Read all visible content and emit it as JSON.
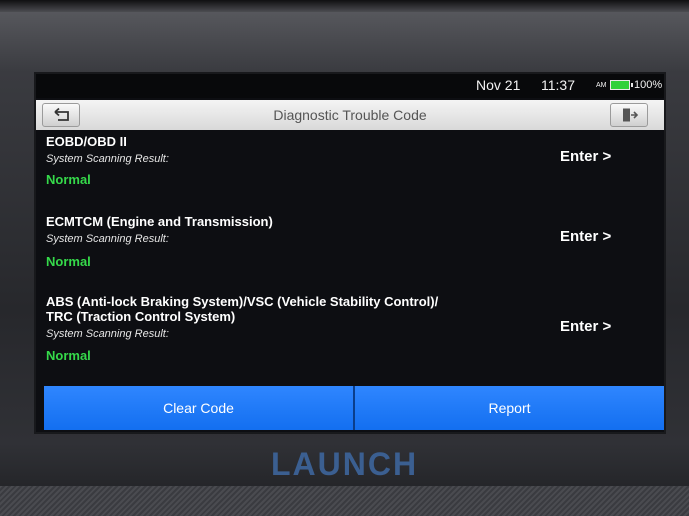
{
  "status_bar": {
    "date": "Nov 21",
    "time": "11:37",
    "ampm": "AM",
    "battery_percent": "100%",
    "battery_level": 1.0,
    "battery_color": "#2fd13a"
  },
  "header": {
    "title": "Diagnostic Trouble Code",
    "back_icon": "back-arrow-icon",
    "exit_icon": "exit-icon"
  },
  "systems": [
    {
      "name_lines": [
        "EOBD/OBD II"
      ],
      "result_label": "System Scanning Result:",
      "status": "Normal",
      "enter_label": "Enter >"
    },
    {
      "name_lines": [
        "ECMTCM (Engine and Transmission)"
      ],
      "result_label": "System Scanning Result:",
      "status": "Normal",
      "enter_label": "Enter >"
    },
    {
      "name_lines": [
        "ABS (Anti-lock Braking System)/VSC (Vehicle Stability Control)/",
        "TRC (Traction Control System)"
      ],
      "result_label": "System Scanning Result:",
      "status": "Normal",
      "enter_label": "Enter >"
    }
  ],
  "footer": {
    "clear_code_label": "Clear Code",
    "report_label": "Report"
  },
  "device": {
    "brand": "LAUNCH"
  },
  "colors": {
    "accent_blue": "#1a78f7",
    "status_ok": "#35d94a"
  }
}
